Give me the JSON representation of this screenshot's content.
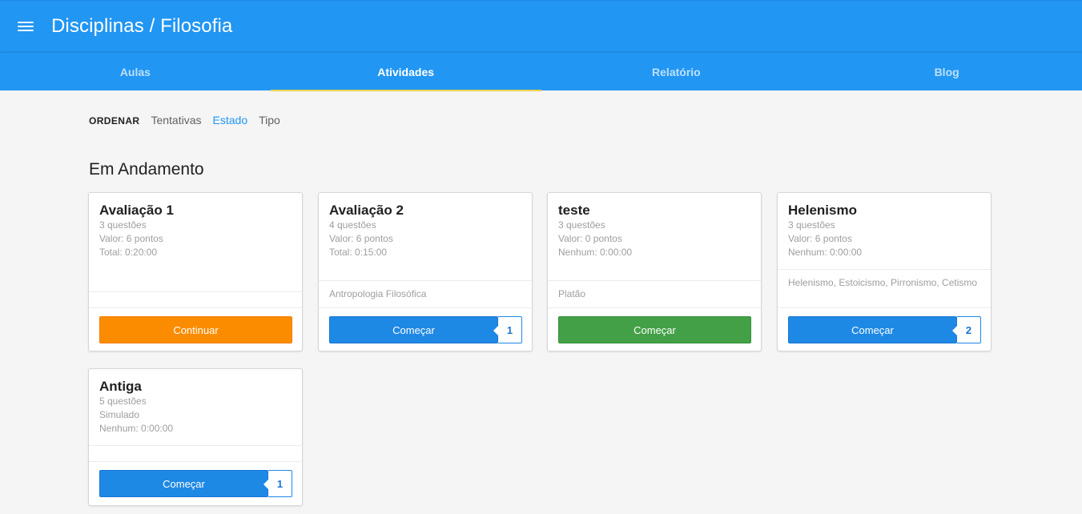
{
  "header": {
    "title": "Disciplinas / Filosofia",
    "menu_icon": "hamburger-menu-icon",
    "color": "#2196f3"
  },
  "tabs": [
    {
      "label": "Aulas",
      "active": false
    },
    {
      "label": "Atividades",
      "active": true
    },
    {
      "label": "Relatório",
      "active": false
    },
    {
      "label": "Blog",
      "active": false
    }
  ],
  "sort": {
    "label": "ORDENAR",
    "options": [
      {
        "label": "Tentativas",
        "selected": false
      },
      {
        "label": "Estado",
        "selected": true
      },
      {
        "label": "Tipo",
        "selected": false
      }
    ]
  },
  "section": {
    "title": "Em Andamento"
  },
  "cards": [
    {
      "title": "Avaliação 1",
      "questions": "3  questões",
      "line2": "Valor: 6 pontos",
      "line3": "Total: 0:20:00",
      "tags": "",
      "button": "Continuar",
      "button_color": "#fb8c00",
      "badge": ""
    },
    {
      "title": "Avaliação 2",
      "questions": "4  questões",
      "line2": "Valor: 6 pontos",
      "line3": "Total: 0:15:00",
      "tags": "Antropologia Filosófica",
      "button": "Começar",
      "button_color": "#1e88e5",
      "badge": "1"
    },
    {
      "title": "teste",
      "questions": "3  questões",
      "line2": "Valor: 0 pontos",
      "line3": "Nenhum: 0:00:00",
      "tags": "Platão",
      "button": "Começar",
      "button_color": "#43a047",
      "badge": ""
    },
    {
      "title": "Helenismo",
      "questions": "3  questões",
      "line2": "Valor: 6 pontos",
      "line3": "Nenhum: 0:00:00",
      "tags": "Helenismo, Estoicismo, Pirronismo, Cetismo",
      "button": "Começar",
      "button_color": "#1e88e5",
      "badge": "2"
    },
    {
      "title": "Antiga",
      "questions": "5  questões",
      "line2": "Simulado",
      "line3": "Nenhum: 0:00:00",
      "tags": "",
      "button": "Começar",
      "button_color": "#1e88e5",
      "badge": "1"
    }
  ]
}
